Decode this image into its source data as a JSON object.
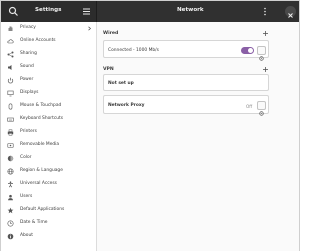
{
  "titlebar": {
    "left_title": "Settings",
    "right_title": "Network"
  },
  "sidebar": {
    "items": [
      {
        "label": "Privacy",
        "icon": "hand-icon",
        "chevron": true
      },
      {
        "label": "Online Accounts",
        "icon": "cloud-icon",
        "chevron": false
      },
      {
        "label": "Sharing",
        "icon": "share-icon",
        "chevron": false
      },
      {
        "label": "Sound",
        "icon": "speaker-icon",
        "chevron": false
      },
      {
        "label": "Power",
        "icon": "power-icon",
        "chevron": false
      },
      {
        "label": "Displays",
        "icon": "display-icon",
        "chevron": false
      },
      {
        "label": "Mouse & Touchpad",
        "icon": "mouse-icon",
        "chevron": false
      },
      {
        "label": "Keyboard Shortcuts",
        "icon": "keyboard-icon",
        "chevron": false
      },
      {
        "label": "Printers",
        "icon": "printer-icon",
        "chevron": false
      },
      {
        "label": "Removable Media",
        "icon": "media-icon",
        "chevron": false
      },
      {
        "label": "Color",
        "icon": "color-icon",
        "chevron": false
      },
      {
        "label": "Region & Language",
        "icon": "globe-icon",
        "chevron": false
      },
      {
        "label": "Universal Access",
        "icon": "accessibility-icon",
        "chevron": false
      },
      {
        "label": "Users",
        "icon": "users-icon",
        "chevron": false
      },
      {
        "label": "Default Applications",
        "icon": "star-icon",
        "chevron": false
      },
      {
        "label": "Date & Time",
        "icon": "clock-icon",
        "chevron": false
      },
      {
        "label": "About",
        "icon": "info-icon",
        "chevron": false
      }
    ]
  },
  "main": {
    "wired": {
      "title": "Wired",
      "connection": "Connected - 1000 Mb/s",
      "toggle_on": true
    },
    "vpn": {
      "title": "VPN",
      "status": "Not set up"
    },
    "proxy": {
      "label": "Network Proxy",
      "value": "Off"
    }
  },
  "colors": {
    "titlebar": "#303030",
    "accent": "#8a5fa6"
  }
}
